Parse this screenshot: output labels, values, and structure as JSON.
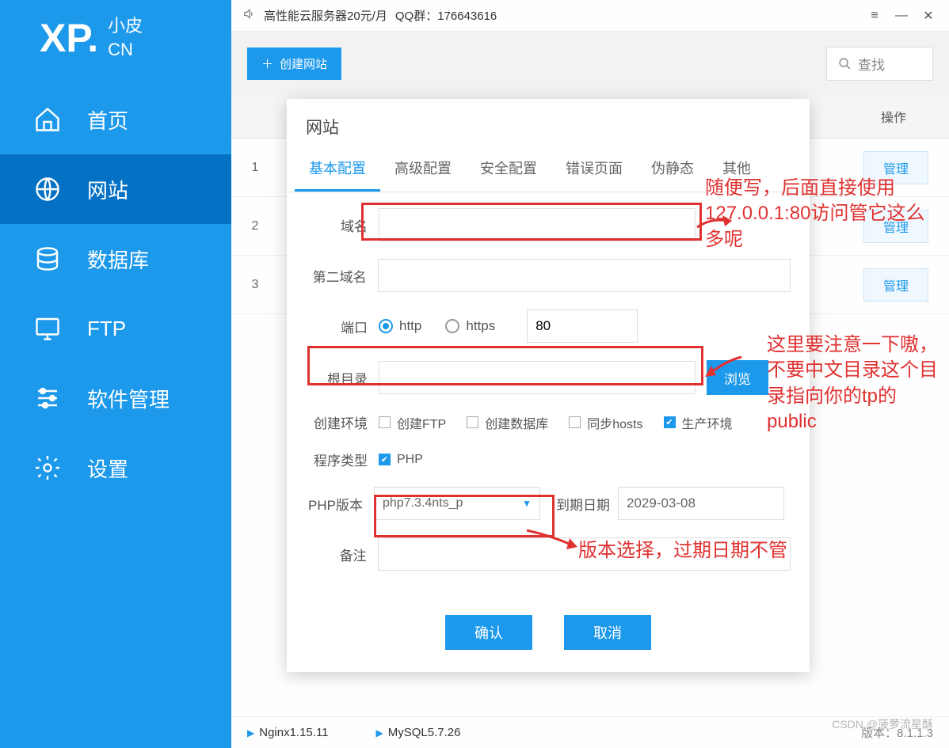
{
  "logo": {
    "xp": "XP.",
    "cn_top": "小皮",
    "cn_bottom": "CN"
  },
  "sidebar": [
    {
      "label": "首页"
    },
    {
      "label": "网站"
    },
    {
      "label": "数据库"
    },
    {
      "label": "FTP"
    },
    {
      "label": "软件管理"
    },
    {
      "label": "设置"
    }
  ],
  "topbar": {
    "promo": "高性能云服务器20元/月",
    "qq": "QQ群：176643616"
  },
  "toolbar": {
    "create": "创建网站",
    "search": "查找"
  },
  "list": {
    "op_header": "操作",
    "rows": [
      "1",
      "2",
      "3"
    ],
    "manage": "管理"
  },
  "modal": {
    "title": "网站",
    "tabs": [
      "基本配置",
      "高级配置",
      "安全配置",
      "错误页面",
      "伪静态",
      "其他"
    ],
    "labels": {
      "domain": "域名",
      "domain2": "第二域名",
      "port": "端口",
      "root": "根目录",
      "env": "创建环境",
      "type": "程序类型",
      "php_ver": "PHP版本",
      "expire": "到期日期",
      "remark": "备注"
    },
    "radios": {
      "http": "http",
      "https": "https"
    },
    "port_value": "80",
    "browse": "浏览",
    "checkboxes": {
      "ftp": "创建FTP",
      "db": "创建数据库",
      "hosts": "同步hosts",
      "prod": "生产环境"
    },
    "check_php": "PHP",
    "php_selected": "php7.3.4nts_p",
    "expire_value": "2029-03-08",
    "ok": "确认",
    "cancel": "取消"
  },
  "status": {
    "nginx": "Nginx1.15.11",
    "mysql": "MySQL5.7.26",
    "version_label": "版本：",
    "version": "8.1.1.3"
  },
  "annotations": {
    "a1": "随便写，后面直接使用127.0.0.1:80访问管它这么多呢",
    "a2": "这里要注意一下嗷，不要中文目录这个目录指向你的tp的public",
    "a3": "版本选择，过期日期不管"
  },
  "watermark": "CSDN @菠萝流星酥"
}
